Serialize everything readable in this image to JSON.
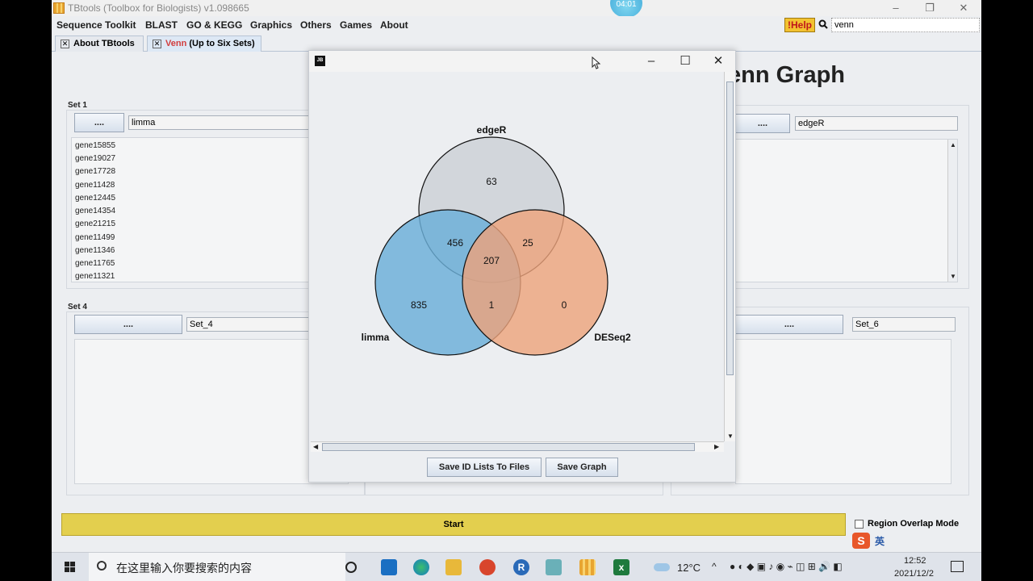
{
  "window": {
    "title": "TBtools (Toolbox for Biologists) v1.098665",
    "timer": "04:01"
  },
  "menu": [
    "Sequence Toolkit",
    "BLAST",
    "GO & KEGG",
    "Graphics",
    "Others",
    "Games",
    "About"
  ],
  "help_label": "!Help",
  "search": {
    "value": "venn"
  },
  "tabs": [
    {
      "label": "About TBtools"
    },
    {
      "prefix": "Venn",
      "label": " (Up to Six Sets)"
    }
  ],
  "heading": "enn Graph",
  "sets": {
    "set1": {
      "label": "Set 1",
      "button": "....",
      "name": "limma",
      "genes": [
        "gene15855",
        "gene19027",
        "gene17728",
        "gene11428",
        "gene12445",
        "gene14354",
        "gene21215",
        "gene11499",
        "gene11346",
        "gene11765",
        "gene11321"
      ]
    },
    "set3": {
      "button": "....",
      "name": "edgeR"
    },
    "set4": {
      "label": "Set 4",
      "button": "....",
      "name": "Set_4"
    },
    "set6": {
      "button": "....",
      "name": "Set_6"
    }
  },
  "start_label": "Start",
  "region_overlap_label": "Region Overlap Mode",
  "dialog": {
    "jb_icon": "JB",
    "venn": {
      "sets": [
        {
          "name": "edgeR",
          "color": "#c9cdd3"
        },
        {
          "name": "limma",
          "color": "#6aaed8"
        },
        {
          "name": "DESeq2",
          "color": "#eea27a"
        }
      ],
      "regions": {
        "edgeR_only": "63",
        "limma_edgeR": "456",
        "edgeR_DESeq2": "25",
        "all_three": "207",
        "limma_only": "835",
        "limma_DESeq2": "1",
        "DESeq2_only": "0"
      }
    },
    "save_id_label": "Save ID Lists To Files",
    "save_graph_label": "Save Graph"
  },
  "taskbar": {
    "search_placeholder": "在这里输入你要搜索的内容",
    "weather": "12°C",
    "time": "12:52",
    "date": "2021/12/2",
    "ime_label": "英"
  }
}
